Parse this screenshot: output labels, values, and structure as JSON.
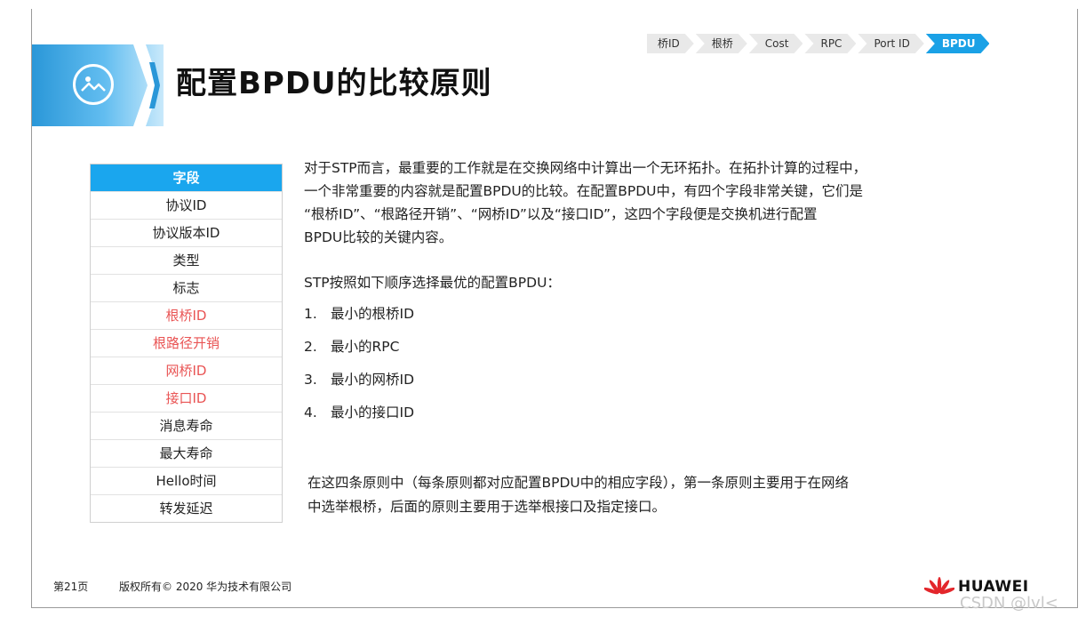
{
  "colors": {
    "accent": "#1aa6ee",
    "key_field": "#e95454",
    "header_band": "#2a97d8"
  },
  "header": {
    "title": "配置BPDU的比较原则",
    "logo_icon": "image-icon"
  },
  "breadcrumb": [
    {
      "label": "桥ID",
      "active": false
    },
    {
      "label": "根桥",
      "active": false
    },
    {
      "label": "Cost",
      "active": false
    },
    {
      "label": "RPC",
      "active": false
    },
    {
      "label": "Port ID",
      "active": false
    },
    {
      "label": "BPDU",
      "active": true
    }
  ],
  "fields": {
    "header": "字段",
    "items": [
      {
        "label": "协议ID",
        "key": false
      },
      {
        "label": "协议版本ID",
        "key": false
      },
      {
        "label": "类型",
        "key": false
      },
      {
        "label": "标志",
        "key": false
      },
      {
        "label": "根桥ID",
        "key": true
      },
      {
        "label": "根路径开销",
        "key": true
      },
      {
        "label": "网桥ID",
        "key": true
      },
      {
        "label": "接口ID",
        "key": true
      },
      {
        "label": "消息寿命",
        "key": false
      },
      {
        "label": "最大寿命",
        "key": false
      },
      {
        "label": "Hello时间",
        "key": false
      },
      {
        "label": "转发延迟",
        "key": false
      }
    ]
  },
  "content": {
    "intro_lines": [
      "对于STP而言，最重要的工作就是在交换网络中计算出一个无环拓扑。在拓扑计算的过程中，",
      "一个非常重要的内容就是配置BPDU的比较。在配置BPDU中，有四个字段非常关键，它们是",
      "“根桥ID”、“根路径开销”、“网桥ID”以及“接口ID”，这四个字段便是交换机进行配置",
      "BPDU比较的关键内容。"
    ],
    "order_intro": "STP按照如下顺序选择最优的配置BPDU：",
    "rules": [
      {
        "num": "1.",
        "text": "最小的根桥ID"
      },
      {
        "num": "2.",
        "text": "最小的RPC"
      },
      {
        "num": "3.",
        "text": "最小的网桥ID"
      },
      {
        "num": "4.",
        "text": "最小的接口ID"
      }
    ],
    "summary_lines": [
      "在这四条原则中（每条原则都对应配置BPDU中的相应字段），第一条原则主要用于在网络",
      "中选举根桥，后面的原则主要用于选举根接口及指定接口。"
    ]
  },
  "footer": {
    "page": "第21页",
    "copyright": "版权所有© 2020 华为技术有限公司",
    "brand": "HUAWEI",
    "brand_icon": "huawei-logo-icon",
    "watermark": "CSDN @lvl<"
  }
}
